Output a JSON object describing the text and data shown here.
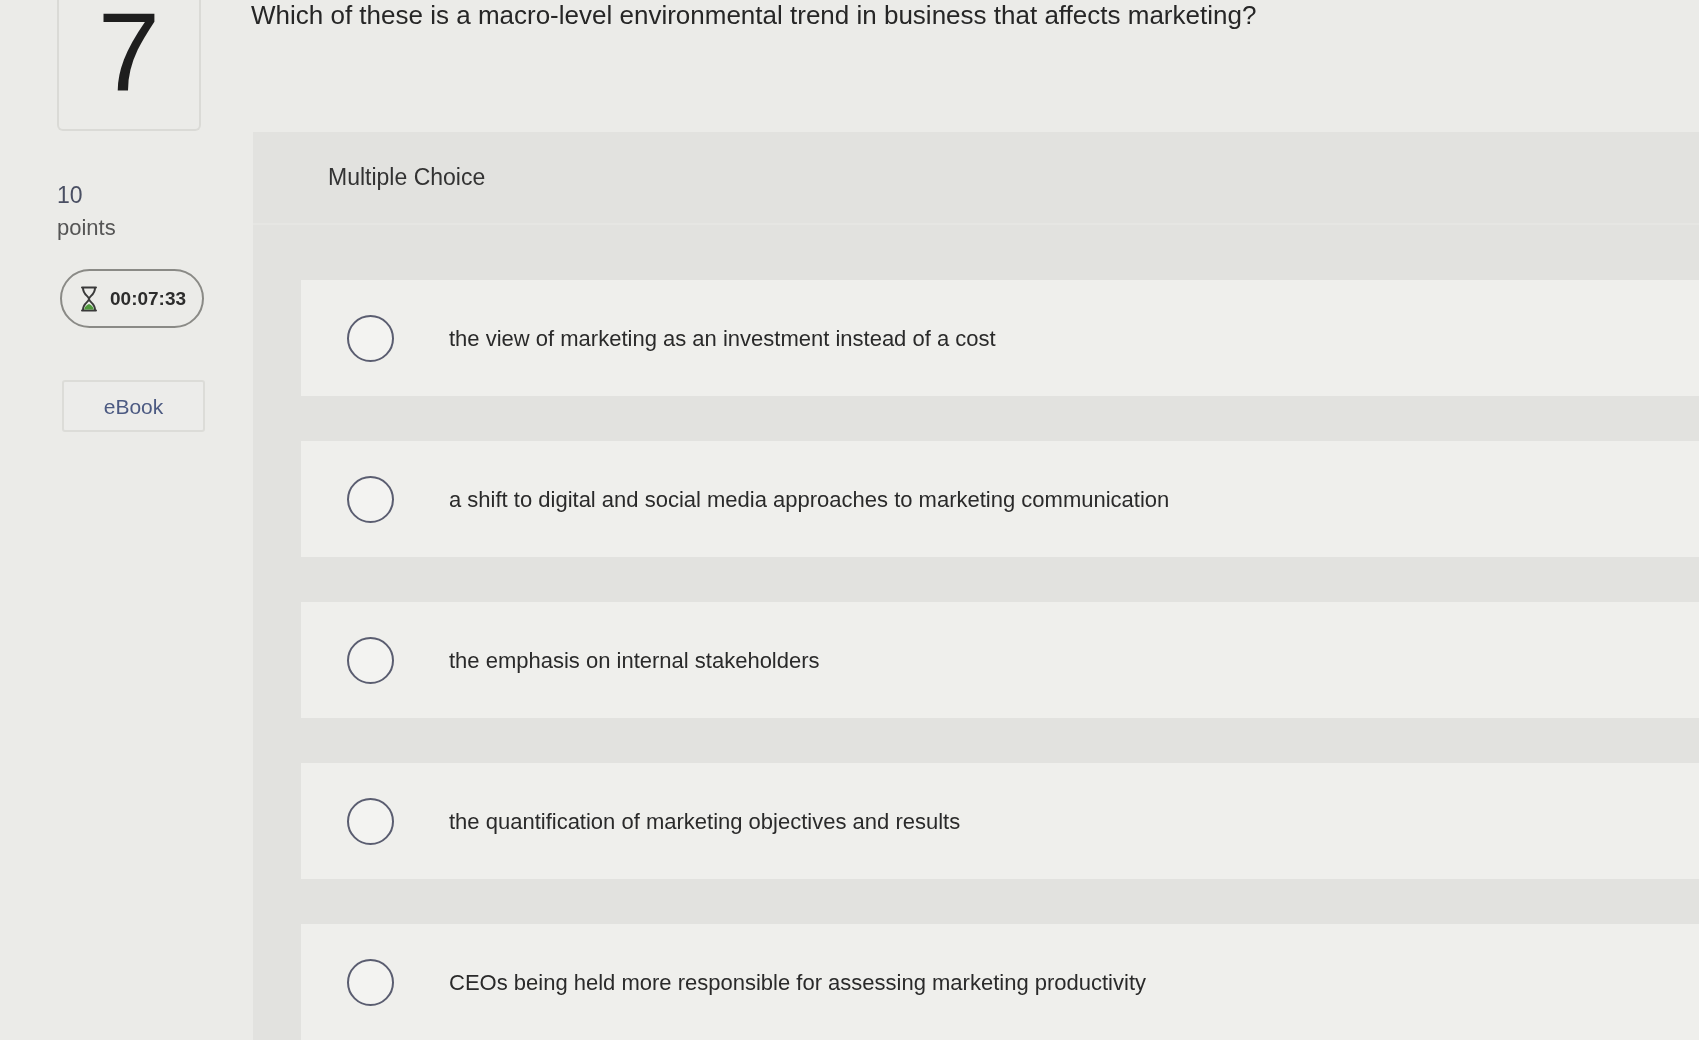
{
  "question": {
    "number": "7",
    "points_value": "10",
    "points_label": "points",
    "timer": "00:07:33",
    "ebook_button": "eBook",
    "text": "Which of these is a macro-level environmental trend in business that affects marketing?"
  },
  "answer_panel": {
    "title": "Multiple Choice",
    "options": [
      {
        "text": "the view of marketing as an investment instead of a cost",
        "selected": false
      },
      {
        "text": "a shift to digital and social media approaches to marketing communication",
        "selected": false
      },
      {
        "text": "the emphasis on internal stakeholders",
        "selected": false
      },
      {
        "text": "the quantification of marketing objectives and results",
        "selected": false
      },
      {
        "text": "CEOs being held more responsible for assessing marketing productivity",
        "selected": false
      }
    ]
  }
}
